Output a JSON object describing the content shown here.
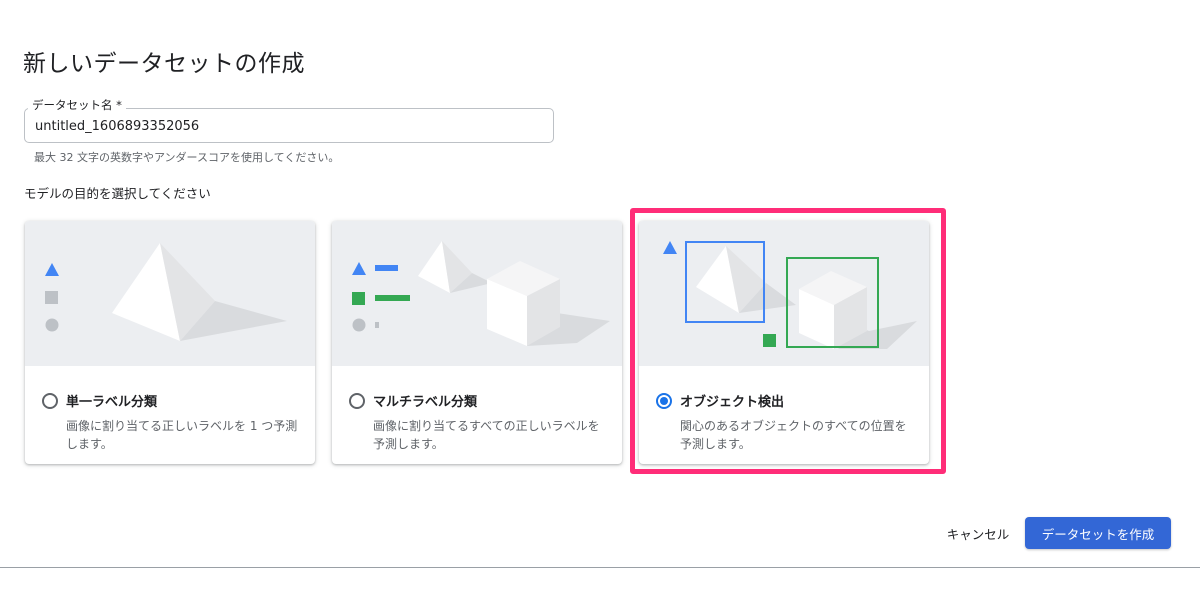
{
  "dialog": {
    "title": "新しいデータセットの作成"
  },
  "dataset_name": {
    "label": "データセット名 *",
    "value": "untitled_1606893352056",
    "hint": "最大 32 文字の英数字やアンダースコアを使用してください。"
  },
  "objective": {
    "heading": "モデルの目的を選択してください",
    "options": [
      {
        "title": "単一ラベル分類",
        "description": "画像に割り当てる正しいラベルを 1 つ予測します。",
        "selected": false,
        "illustration": "single-label-illustration"
      },
      {
        "title": "マルチラベル分類",
        "description": "画像に割り当てるすべての正しいラベルを予測します。",
        "selected": false,
        "illustration": "multi-label-illustration"
      },
      {
        "title": "オブジェクト検出",
        "description": "関心のあるオブジェクトのすべての位置を予測します。",
        "selected": true,
        "illustration": "object-detection-illustration"
      }
    ]
  },
  "actions": {
    "cancel_label": "キャンセル",
    "create_label": "データセットを作成"
  },
  "colors": {
    "primary": "#3367d6",
    "radio_selected": "#1a73e8",
    "highlight": "#ff2d78",
    "shape_blue": "#4285f4",
    "shape_green": "#34a853",
    "shape_gray": "#bdc1c6",
    "illustration_bg": "#eceef1"
  }
}
